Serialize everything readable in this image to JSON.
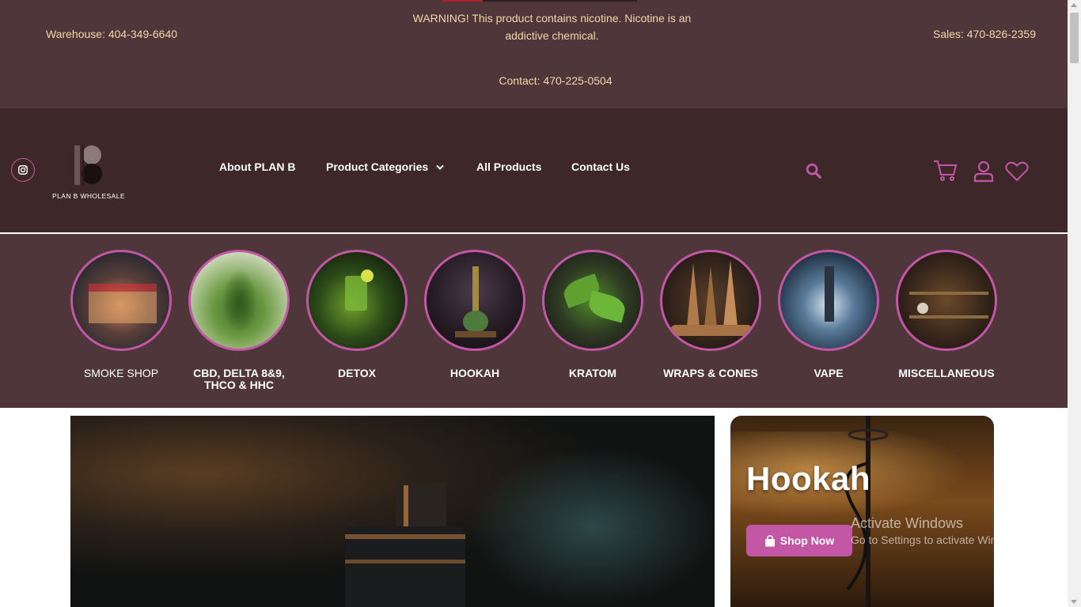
{
  "topbar": {
    "warehouse": "Warehouse: 404-349-6640",
    "warning": "WARNING! This product contains nicotine. Nicotine is an addictive chemical.",
    "sales": "Sales: 470-826-2359",
    "contact": "Contact: 470-225-0504"
  },
  "header": {
    "logo_text": "PLAN B WHOLESALE",
    "nav": {
      "about": "About PLAN B",
      "categories": "Product Categories",
      "all_products": "All Products",
      "contact": "Contact Us"
    },
    "icons": [
      "instagram-icon",
      "search-icon",
      "cart-icon",
      "user-icon",
      "heart-icon"
    ]
  },
  "categories": [
    {
      "label": "SMOKE SHOP"
    },
    {
      "label": "CBD, DELTA 8&9, THCO & HHC"
    },
    {
      "label": "DETOX"
    },
    {
      "label": "HOOKAH"
    },
    {
      "label": "KRATOM"
    },
    {
      "label": "WRAPS & CONES"
    },
    {
      "label": "VAPE"
    },
    {
      "label": "MISCELLANEOUS"
    }
  ],
  "banner_right": {
    "title": "Hookah",
    "button": "Shop Now"
  },
  "watermark": {
    "line1": "Activate Windows",
    "line2": "Go to Settings to activate Windows."
  },
  "colors": {
    "topbar_bg": "#4f363a",
    "header_bg": "#3e2729",
    "accent": "#c357a6",
    "topbar_text": "#f4d7a7"
  }
}
